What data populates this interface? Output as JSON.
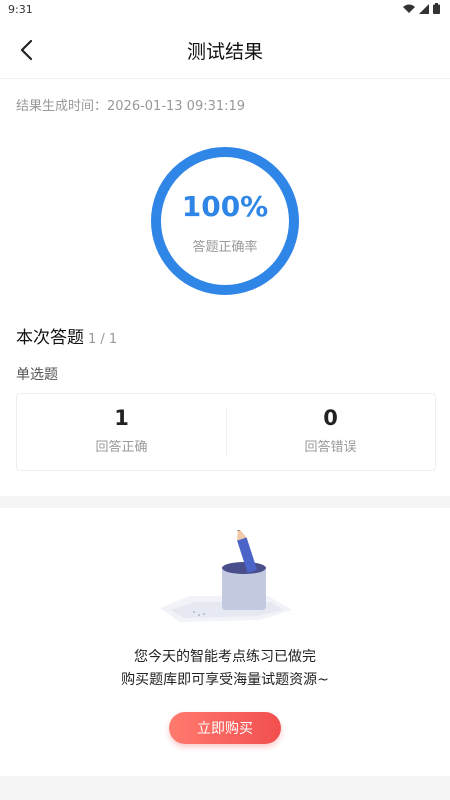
{
  "status_bar": {
    "time": "9:31"
  },
  "header": {
    "title": "测试结果"
  },
  "result": {
    "generated_at": "结果生成时间：2026-01-13 09:31:19",
    "accuracy_value": 1.0,
    "accuracy_text": "100%",
    "accuracy_label": "答题正确率"
  },
  "summary": {
    "title": "本次答题",
    "count": "1 / 1",
    "question_type": "单选题",
    "stats": [
      {
        "value": "1",
        "label": "回答正确"
      },
      {
        "value": "0",
        "label": "回答错误"
      }
    ]
  },
  "promo": {
    "line1": "您今天的智能考点练习已做完",
    "line2": "购买题库即可享受海量试题资源~",
    "button": "立即购买"
  },
  "colors": {
    "accent": "#2f86e6",
    "buy_start": "#ff7a6e",
    "buy_end": "#f24f4f"
  },
  "icons": {
    "back": "chevron-left-icon",
    "wifi": "wifi-icon",
    "signal": "signal-icon",
    "battery": "battery-icon"
  }
}
